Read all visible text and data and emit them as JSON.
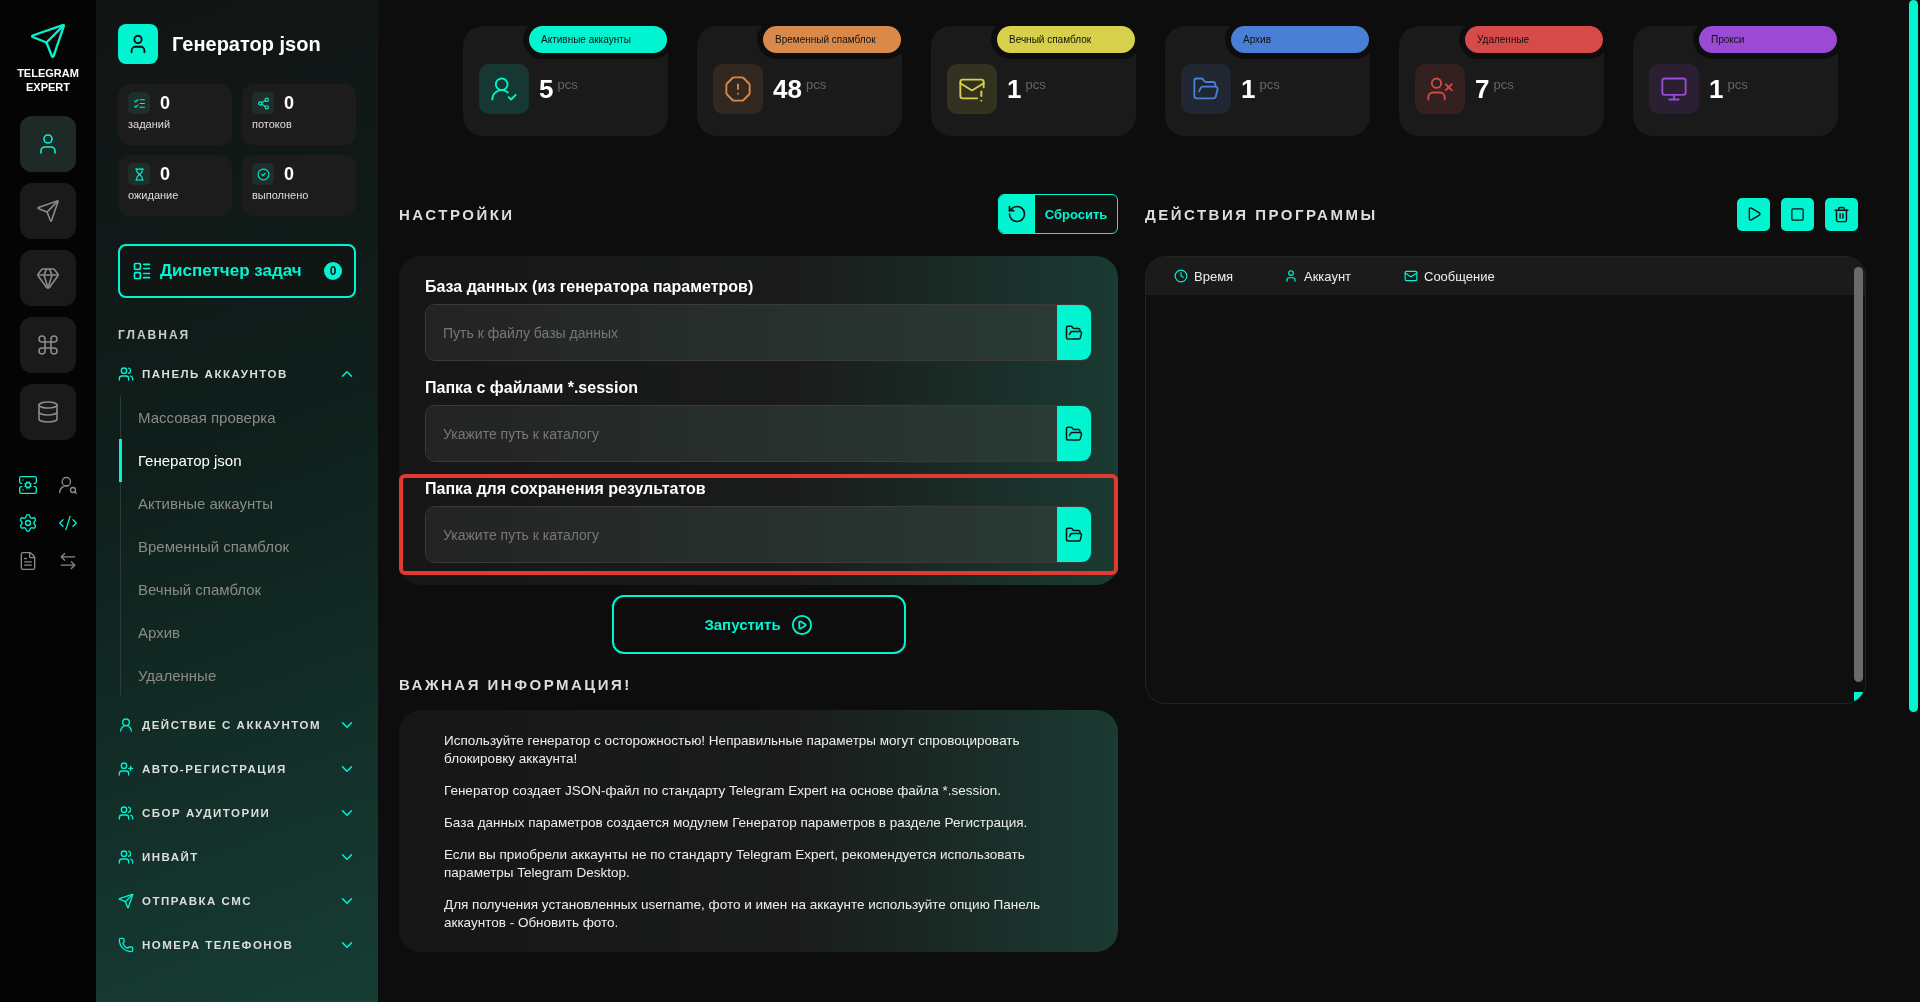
{
  "brand": {
    "line1": "TELEGRAM",
    "line2": "EXPERT"
  },
  "rail": [
    {
      "selected": true
    },
    {
      "selected": false
    },
    {
      "selected": false
    },
    {
      "selected": false
    },
    {
      "selected": false
    }
  ],
  "tools": [
    {
      "active": true
    },
    {
      "active": false
    },
    {
      "active": true
    },
    {
      "active": true
    },
    {
      "active": false
    },
    {
      "active": false
    }
  ],
  "sidebar": {
    "title": "Генератор json",
    "counters": [
      {
        "value": "0",
        "label": "заданий"
      },
      {
        "value": "0",
        "label": "потоков"
      },
      {
        "value": "0",
        "label": "ожидание"
      },
      {
        "value": "0",
        "label": "выполнено"
      }
    ],
    "dispatcher": {
      "label": "Диспетчер задач",
      "count": "0"
    },
    "section": "ГЛАВНАЯ",
    "groups": [
      {
        "label": "ПАНЕЛЬ АККАУНТОВ",
        "expanded": true,
        "children": [
          {
            "label": "Массовая проверка",
            "selected": false
          },
          {
            "label": "Генератор json",
            "selected": true
          },
          {
            "label": "Активные аккаунты",
            "selected": false
          },
          {
            "label": "Временный спамблок",
            "selected": false
          },
          {
            "label": "Вечный спамблок",
            "selected": false
          },
          {
            "label": "Архив",
            "selected": false
          },
          {
            "label": "Удаленные",
            "selected": false
          }
        ]
      },
      {
        "label": "ДЕЙСТВИЕ С АККАУНТОМ",
        "expanded": false
      },
      {
        "label": "АВТО-РЕГИСТРАЦИЯ",
        "expanded": false
      },
      {
        "label": "СБОР АУДИТОРИИ",
        "expanded": false
      },
      {
        "label": "ИНВАЙТ",
        "expanded": false
      },
      {
        "label": "ОТПРАВКА СМС",
        "expanded": false
      },
      {
        "label": "НОМЕРА ТЕЛЕФОНОВ",
        "expanded": false
      }
    ]
  },
  "stats": [
    {
      "label": "Активные аккаунты",
      "count": "5",
      "unit": "pcs",
      "color": "#00f5d0"
    },
    {
      "label": "Временный спамблок",
      "count": "48",
      "unit": "pcs",
      "color": "#d98a4a"
    },
    {
      "label": "Вечный спамблок",
      "count": "1",
      "unit": "pcs",
      "color": "#d6d04a"
    },
    {
      "label": "Архив",
      "count": "1",
      "unit": "pcs",
      "color": "#4a7fd6"
    },
    {
      "label": "Удаленные",
      "count": "7",
      "unit": "pcs",
      "color": "#d64a4a"
    },
    {
      "label": "Прокси",
      "count": "1",
      "unit": "pcs",
      "color": "#9b4ad6"
    }
  ],
  "settings": {
    "title": "НАСТРОЙКИ",
    "reset": "Сбросить",
    "fields": [
      {
        "label": "База данных (из генератора параметров)",
        "placeholder": "Путь к файлу базы данных",
        "highlighted": false
      },
      {
        "label": "Папка с файлами *.session",
        "placeholder": "Укажите путь к каталогу",
        "highlighted": false
      },
      {
        "label": "Папка для сохранения результатов",
        "placeholder": "Укажите путь к каталогу",
        "highlighted": true
      }
    ],
    "run": "Запустить"
  },
  "info": {
    "title": "ВАЖНАЯ ИНФОРМАЦИЯ!",
    "paragraphs": [
      "Используйте генератор с осторожностью! Неправильные параметры могут спровоцировать блокировку аккаунта!",
      "Генератор создает JSON-файл по стандарту Telegram Expert на основе файла *.session.",
      "База данных параметров создается модулем Генератор параметров в разделе Регистрация.",
      "Если вы приобрели аккаунты не по стандарту Telegram Expert, рекомендуется использовать параметры Telegram Desktop.",
      "Для получения установленных username, фото и имен на аккаунте используйте опцию Панель аккаунтов - Обновить фото."
    ]
  },
  "log": {
    "title": "ДЕЙСТВИЯ ПРОГРАММЫ",
    "columns": [
      "Время",
      "Аккаунт",
      "Сообщение"
    ]
  }
}
